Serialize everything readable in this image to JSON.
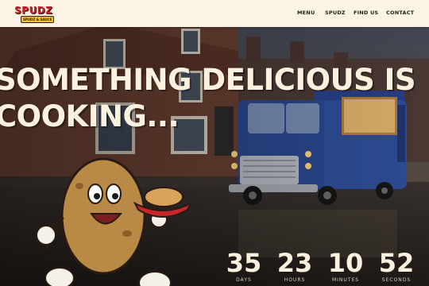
{
  "brand": {
    "name": "SPUDZ",
    "tagline": "SPUDZ & SAUCE",
    "colors": {
      "primary": "#c9262c",
      "accent": "#f1c232",
      "nav_bg": "#fbf4e5",
      "text_light": "#fbf1df"
    }
  },
  "nav": {
    "items": [
      {
        "label": "MENU"
      },
      {
        "label": "SPUDZ"
      },
      {
        "label": "FIND US"
      },
      {
        "label": "CONTACT"
      }
    ]
  },
  "hero": {
    "headline_line1": "SOMETHING DELICIOUS IS",
    "headline_line2": "COOKING..."
  },
  "countdown": {
    "units": [
      {
        "value": "35",
        "label": "DAYS"
      },
      {
        "value": "23",
        "label": "HOURS"
      },
      {
        "value": "10",
        "label": "MINUTES"
      },
      {
        "value": "52",
        "label": "SECONDS"
      }
    ]
  },
  "icons": {
    "mascot": "potato-mascot-icon",
    "truck": "food-truck-icon"
  }
}
